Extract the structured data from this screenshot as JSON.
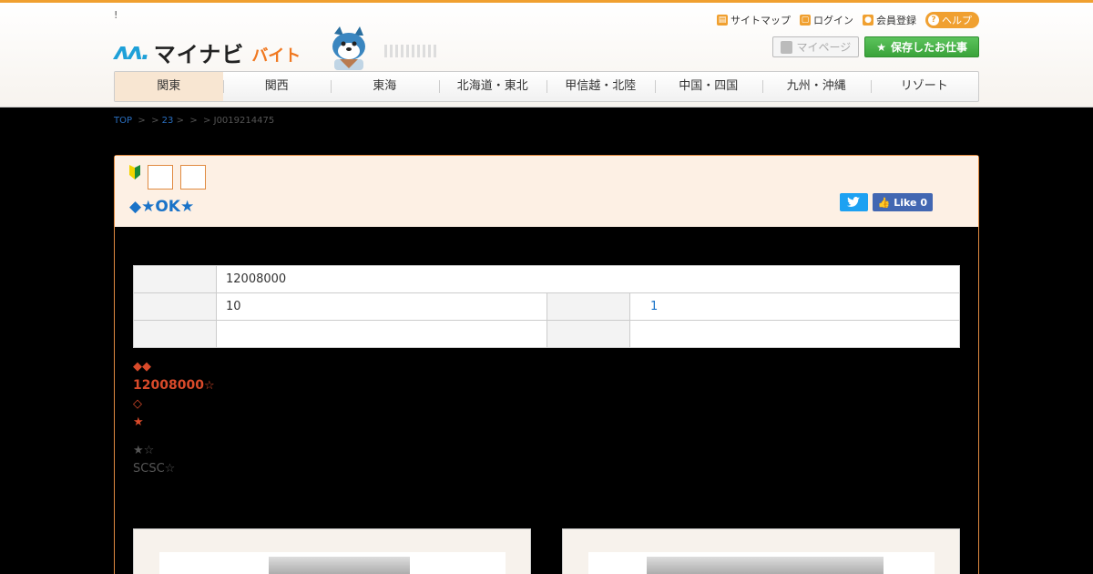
{
  "header": {
    "notice": "!",
    "logo_mark": "ʌʌ.",
    "logo_text": "マイナビ",
    "logo_sub": "バイト",
    "links": [
      {
        "label": "サイトマップ",
        "icon": "sitemap-icon"
      },
      {
        "label": "ログイン",
        "icon": "lock-icon"
      },
      {
        "label": "会員登録",
        "icon": "user-icon"
      }
    ],
    "help_label": "ヘルプ",
    "mypage_label": "マイページ",
    "saved_jobs_label": "保存したお仕事"
  },
  "nav": [
    "関東",
    "関西",
    "東海",
    "北海道・東北",
    "甲信越・北陸",
    "中国・四国",
    "九州・沖縄",
    "リゾート"
  ],
  "breadcrumb": {
    "top": "TOP",
    "mid": "  >  > ",
    "num": "23",
    "rest": " >  >  > J0019214475"
  },
  "job": {
    "title": "◆★OK★",
    "facebook_label": "Like 0",
    "table": {
      "r1_value": "12008000",
      "r2_value": "10",
      "r2_link": "1"
    },
    "desc": {
      "line1": "◆◆",
      "line2_bold": "12008000",
      "line2_star": "☆",
      "line3": "◇",
      "line4": "★",
      "line5": "★☆",
      "line6": "SCSC☆"
    }
  },
  "colors": {
    "accent": "#f0a030",
    "link": "#1a73c8",
    "save_green": "#3aa33a",
    "nav_active": "#f8e6d2",
    "title_bg": "#fdf0e4"
  }
}
